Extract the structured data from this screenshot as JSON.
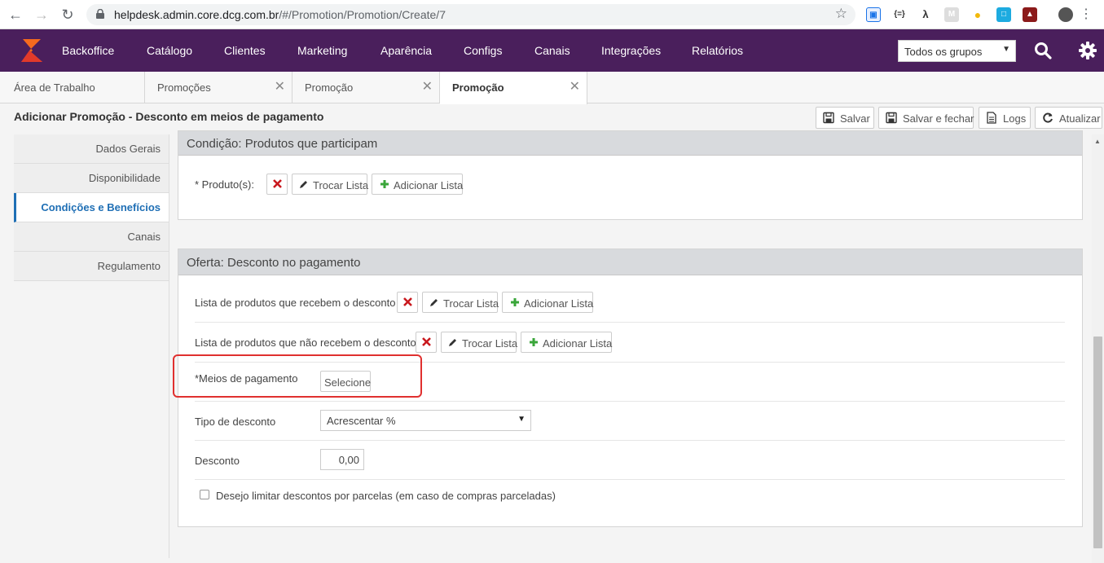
{
  "browser": {
    "url_host": "helpdesk.admin.core.dcg.com.br",
    "url_path": "/#/Promotion/Promotion/Create/7"
  },
  "topnav": {
    "items": [
      "Backoffice",
      "Catálogo",
      "Clientes",
      "Marketing",
      "Aparência",
      "Configs",
      "Canais",
      "Integrações",
      "Relatórios"
    ],
    "group_select": "Todos os grupos"
  },
  "tabs": [
    {
      "label": "Área de Trabalho",
      "closable": false
    },
    {
      "label": "Promoções",
      "closable": true
    },
    {
      "label": "Promoção",
      "closable": true
    },
    {
      "label": "Promoção",
      "closable": true,
      "active": true
    }
  ],
  "page": {
    "title": "Adicionar Promoção - Desconto em meios de pagamento",
    "actions": {
      "save": "Salvar",
      "save_close": "Salvar e fechar",
      "logs": "Logs",
      "refresh": "Atualizar"
    }
  },
  "side_menu": [
    {
      "label": "Dados Gerais"
    },
    {
      "label": "Disponibilidade"
    },
    {
      "label": "Condições e Benefícios",
      "active": true
    },
    {
      "label": "Canais"
    },
    {
      "label": "Regulamento"
    }
  ],
  "condition_panel": {
    "title": "Condição: Produtos que participam",
    "products_label": "* Produto(s):",
    "swap_label": "Trocar Lista",
    "add_label": "Adicionar Lista"
  },
  "offer_panel": {
    "title": "Oferta: Desconto no pagamento",
    "included_label": "Lista de produtos que recebem o desconto",
    "excluded_label": "Lista de produtos que não recebem o desconto",
    "swap_label": "Trocar Lista",
    "add_label": "Adicionar Lista",
    "payment_label": "*Meios de pagamento",
    "payment_button": "Selecione",
    "discount_type_label": "Tipo de desconto",
    "discount_type_value": "Acrescentar %",
    "discount_label": "Desconto",
    "discount_value": "0,00",
    "installments_label": "Desejo limitar descontos por parcelas (em caso de compras parceladas)",
    "installments_checked": false
  },
  "colors": {
    "topnav_bg": "#4a1f5c",
    "active_accent": "#1f6fb5",
    "remove_red": "#c9181e",
    "add_green": "#3aa63a",
    "highlight_red": "#e0302f"
  }
}
